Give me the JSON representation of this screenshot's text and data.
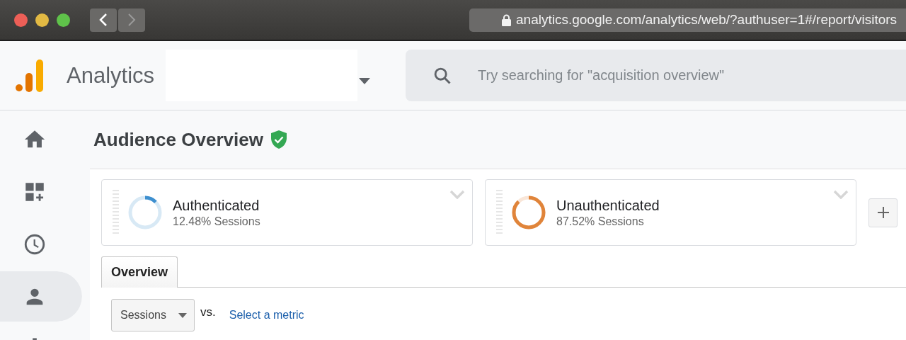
{
  "browser": {
    "url": "analytics.google.com/analytics/web/?authuser=1#/report/visitors"
  },
  "header": {
    "app_name": "Analytics",
    "search": {
      "placeholder": "Try searching for \"acquisition overview\""
    }
  },
  "sidebar": {
    "items": [
      {
        "selected": false
      },
      {
        "selected": false
      },
      {
        "selected": false
      },
      {
        "selected": true
      },
      {
        "selected": false
      }
    ]
  },
  "page": {
    "title": "Audience Overview"
  },
  "segments": [
    {
      "name": "Authenticated",
      "detail": "12.48% Sessions",
      "level": 0.1248,
      "color": "#3d8fcf"
    },
    {
      "name": "Unauthenticated",
      "detail": "87.52% Sessions",
      "level": 0.8752,
      "color": "#e0843a"
    }
  ],
  "tabs": [
    {
      "label": "Overview",
      "selected": true
    }
  ],
  "metric": {
    "value": "Sessions",
    "vs": "vs.",
    "link": "Select a metric"
  }
}
